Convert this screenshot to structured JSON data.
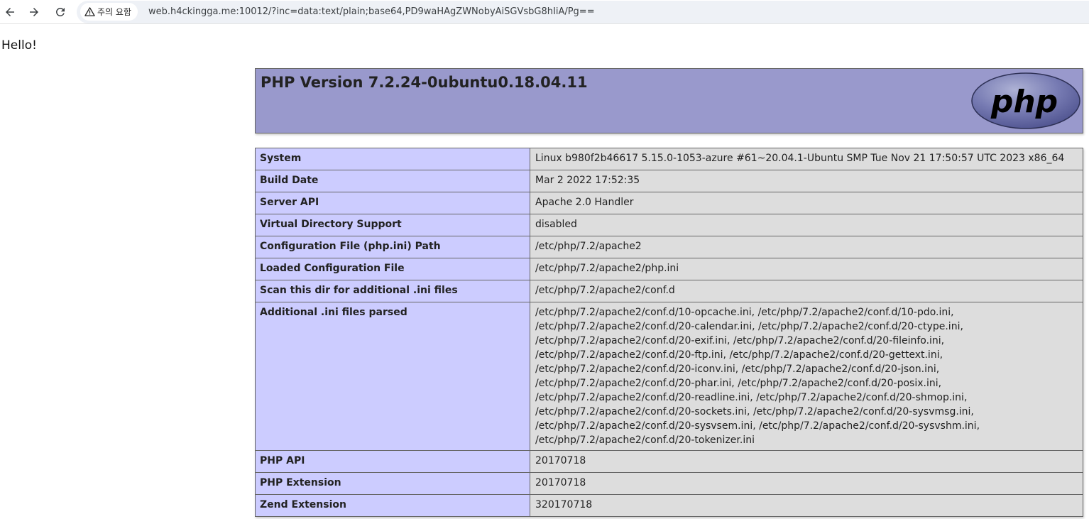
{
  "browser": {
    "security_label": "주의 요함",
    "url": "web.h4ckingga.me:10012/?inc=data:text/plain;base64,PD9waHAgZWNobyAiSGVsbG8hIiA/Pg==",
    "icons": [
      "back-arrow-icon",
      "forward-arrow-icon",
      "reload-icon",
      "warning-triangle-icon"
    ]
  },
  "page": {
    "hello_text": "Hello!",
    "php_version_title": "PHP Version 7.2.24-0ubuntu0.18.04.11",
    "logo_text": "php",
    "colors": {
      "header_bg": "#9999cc",
      "key_bg": "#ccccff",
      "value_bg": "#dddddd",
      "border": "#666666"
    }
  },
  "info_rows": [
    {
      "key": "System",
      "value": "Linux b980f2b46617 5.15.0-1053-azure #61~20.04.1-Ubuntu SMP Tue Nov 21 17:50:57 UTC 2023 x86_64"
    },
    {
      "key": "Build Date",
      "value": "Mar 2 2022 17:52:35"
    },
    {
      "key": "Server API",
      "value": "Apache 2.0 Handler"
    },
    {
      "key": "Virtual Directory Support",
      "value": "disabled"
    },
    {
      "key": "Configuration File (php.ini) Path",
      "value": "/etc/php/7.2/apache2"
    },
    {
      "key": "Loaded Configuration File",
      "value": "/etc/php/7.2/apache2/php.ini"
    },
    {
      "key": "Scan this dir for additional .ini files",
      "value": "/etc/php/7.2/apache2/conf.d"
    },
    {
      "key": "Additional .ini files parsed",
      "value_lines": [
        "/etc/php/7.2/apache2/conf.d/10-opcache.ini, /etc/php/7.2/apache2/conf.d/10-pdo.ini,",
        "/etc/php/7.2/apache2/conf.d/20-calendar.ini, /etc/php/7.2/apache2/conf.d/20-ctype.ini,",
        "/etc/php/7.2/apache2/conf.d/20-exif.ini, /etc/php/7.2/apache2/conf.d/20-fileinfo.ini,",
        "/etc/php/7.2/apache2/conf.d/20-ftp.ini, /etc/php/7.2/apache2/conf.d/20-gettext.ini,",
        "/etc/php/7.2/apache2/conf.d/20-iconv.ini, /etc/php/7.2/apache2/conf.d/20-json.ini,",
        "/etc/php/7.2/apache2/conf.d/20-phar.ini, /etc/php/7.2/apache2/conf.d/20-posix.ini,",
        "/etc/php/7.2/apache2/conf.d/20-readline.ini, /etc/php/7.2/apache2/conf.d/20-shmop.ini,",
        "/etc/php/7.2/apache2/conf.d/20-sockets.ini, /etc/php/7.2/apache2/conf.d/20-sysvmsg.ini,",
        "/etc/php/7.2/apache2/conf.d/20-sysvsem.ini, /etc/php/7.2/apache2/conf.d/20-sysvshm.ini,",
        "/etc/php/7.2/apache2/conf.d/20-tokenizer.ini"
      ]
    },
    {
      "key": "PHP API",
      "value": "20170718"
    },
    {
      "key": "PHP Extension",
      "value": "20170718"
    },
    {
      "key": "Zend Extension",
      "value": "320170718"
    }
  ]
}
